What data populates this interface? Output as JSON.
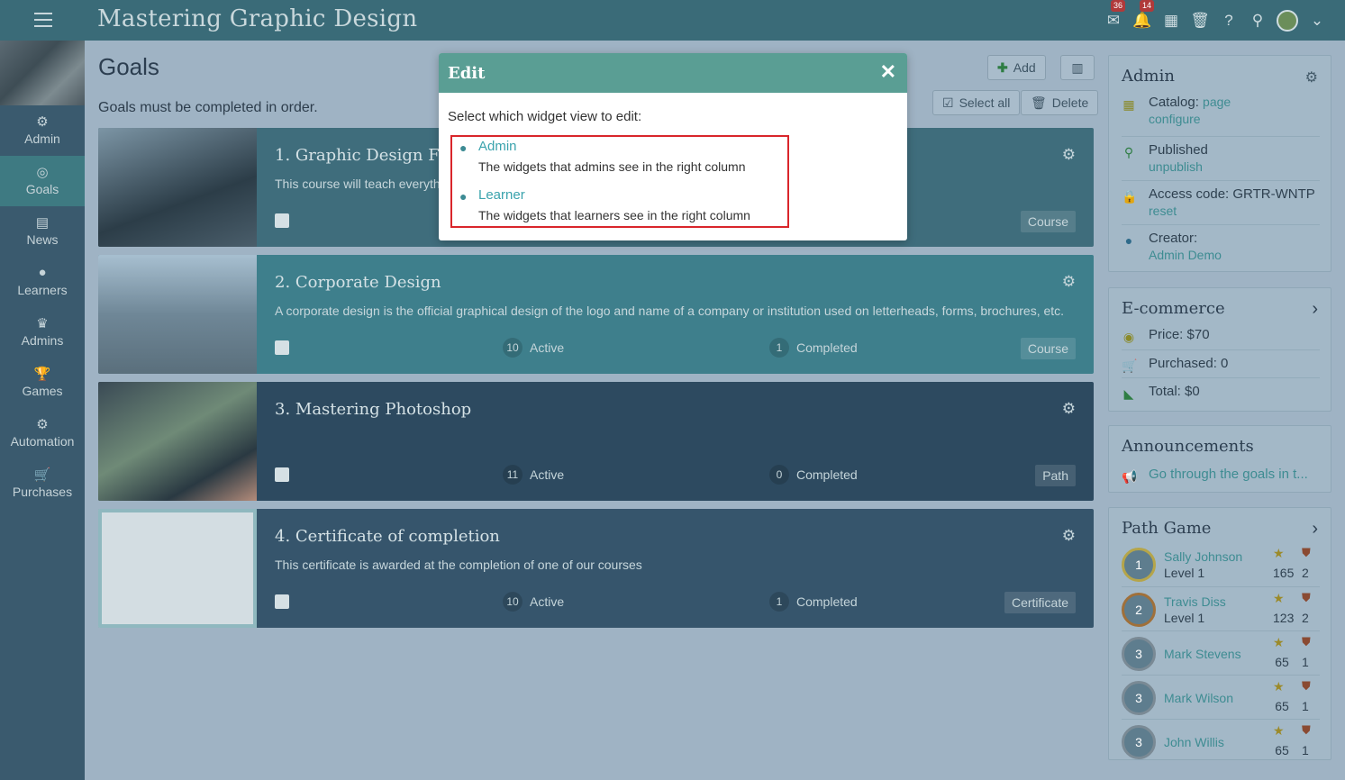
{
  "header": {
    "title": "Mastering Graphic Design",
    "messages_badge": "36",
    "notifications_badge": "14"
  },
  "sidebar": {
    "items": [
      {
        "label": "Admin",
        "icon": "gear-icon"
      },
      {
        "label": "Goals",
        "icon": "target-icon",
        "active": true
      },
      {
        "label": "News",
        "icon": "news-icon"
      },
      {
        "label": "Learners",
        "icon": "user-icon"
      },
      {
        "label": "Admins",
        "icon": "crown-icon"
      },
      {
        "label": "Games",
        "icon": "trophy-icon"
      },
      {
        "label": "Automation",
        "icon": "gears-icon"
      },
      {
        "label": "Purchases",
        "icon": "cart-icon"
      }
    ]
  },
  "main": {
    "title": "Goals",
    "subtitle": "Goals must be completed in order.",
    "add_label": "Add",
    "select_all_label": "Select all",
    "delete_label": "Delete",
    "goals": [
      {
        "title": "1. Graphic Design Fur",
        "desc": "This course will teach everyth",
        "active": "",
        "active_label": "",
        "completed": "",
        "completed_label": "",
        "type": "Course",
        "bg": "#3f6d7c"
      },
      {
        "title": "2. Corporate Design",
        "desc": "A corporate design is the official graphical design of the logo and name of a company or institution used on letterheads, forms, brochures, etc.",
        "active": "10",
        "active_label": "Active",
        "completed": "1",
        "completed_label": "Completed",
        "type": "Course",
        "bg": "#3e7f8c"
      },
      {
        "title": "3. Mastering Photoshop",
        "desc": "",
        "active": "11",
        "active_label": "Active",
        "completed": "0",
        "completed_label": "Completed",
        "type": "Path",
        "bg": "#2d4a60"
      },
      {
        "title": "4. Certificate of completion",
        "desc": "This certificate is awarded at the completion of one of our courses",
        "active": "10",
        "active_label": "Active",
        "completed": "1",
        "completed_label": "Completed",
        "type": "Certificate",
        "bg": "#36556c"
      }
    ]
  },
  "admin_panel": {
    "title": "Admin",
    "catalog_label": "Catalog:",
    "catalog_value": "page",
    "catalog_link": "configure",
    "published_label": "Published",
    "published_link": "unpublish",
    "access_label": "Access code: GRTR-WNTP",
    "access_link": "reset",
    "creator_label": "Creator:",
    "creator_link": "Admin Demo"
  },
  "ecommerce_panel": {
    "title": "E-commerce",
    "price": "Price: $70",
    "purchased": "Purchased: 0",
    "total": "Total: $0"
  },
  "announcements_panel": {
    "title": "Announcements",
    "item": "Go through the goals in t..."
  },
  "path_game_panel": {
    "title": "Path Game",
    "players": [
      {
        "rank": "1",
        "name": "Sally Johnson",
        "level": "Level 1",
        "points": "165",
        "badges": "2"
      },
      {
        "rank": "2",
        "name": "Travis Diss",
        "level": "Level 1",
        "points": "123",
        "badges": "2"
      },
      {
        "rank": "3",
        "name": "Mark Stevens",
        "level": "",
        "points": "65",
        "badges": "1"
      },
      {
        "rank": "3",
        "name": "Mark Wilson",
        "level": "",
        "points": "65",
        "badges": "1"
      },
      {
        "rank": "3",
        "name": "John Willis",
        "level": "",
        "points": "65",
        "badges": "1"
      }
    ]
  },
  "modal": {
    "title": "Edit",
    "instruction": "Select which widget view to edit:",
    "options": [
      {
        "label": "Admin",
        "desc": "The widgets that admins see in the right column"
      },
      {
        "label": "Learner",
        "desc": "The widgets that learners see in the right column"
      }
    ]
  },
  "colors": {
    "accent": "#3e8c92",
    "modal_header": "#5a9e94",
    "highlight_border": "#d9262b"
  }
}
